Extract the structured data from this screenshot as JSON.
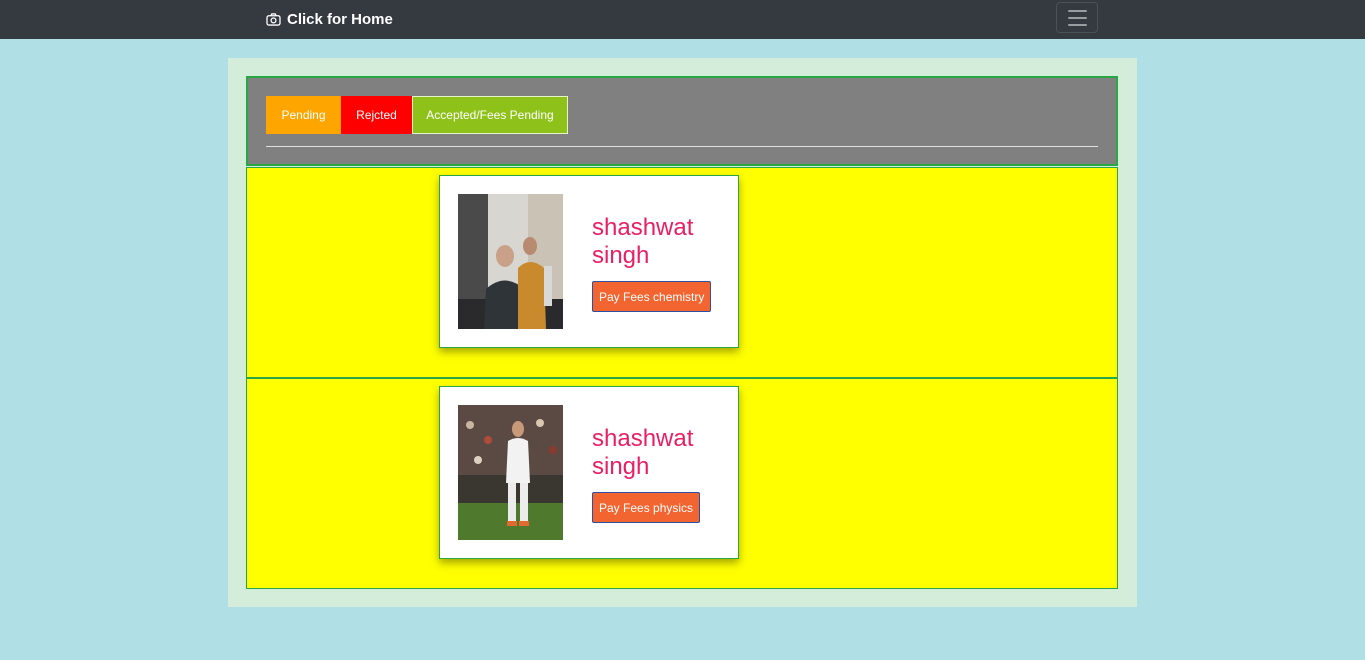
{
  "navbar": {
    "brand_label": "Click for Home",
    "brand_icon": "camera-icon",
    "toggler_icon": "hamburger-icon",
    "background": "#343a40"
  },
  "tabs": [
    {
      "label": "Pending",
      "color": "#ffa500"
    },
    {
      "label": "Rejcted",
      "color": "#ff0000"
    },
    {
      "label": "Accepted/Fees Pending",
      "color": "#8ec21a"
    }
  ],
  "students": [
    {
      "name": "shashwat singh",
      "button_label": "Pay Fees chemistry"
    },
    {
      "name": "shashwat singh",
      "button_label": "Pay Fees physics"
    }
  ],
  "colors": {
    "page_background": "#b0dfe5",
    "container_background": "#d4eddb",
    "row_background": "#ffff00",
    "name_color": "#e91e63",
    "button_color": "#f26430",
    "border_green": "#28a745"
  }
}
